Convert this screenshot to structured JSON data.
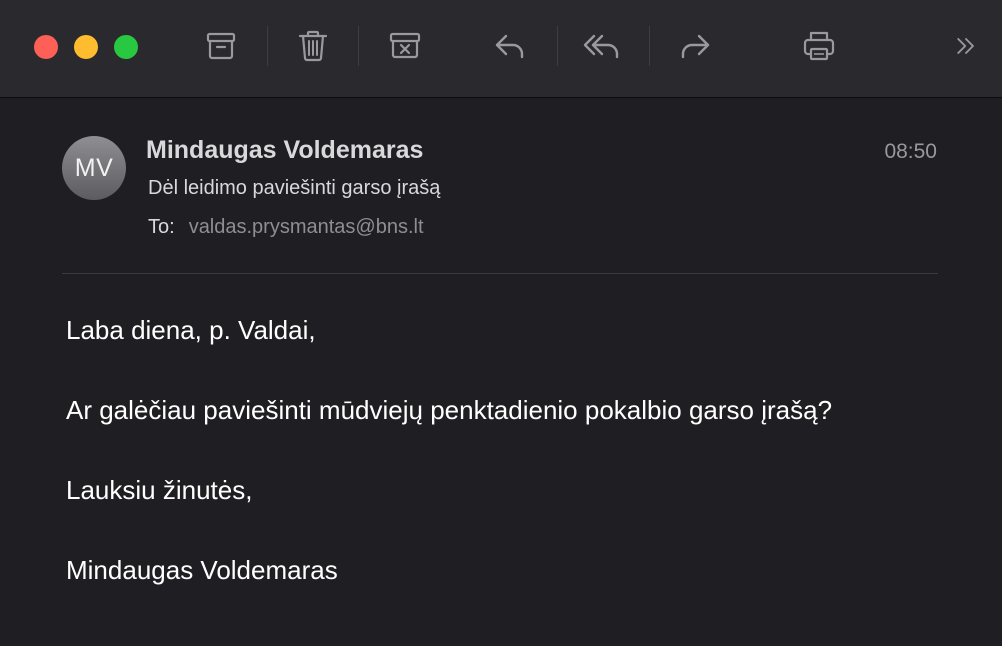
{
  "window": {
    "traffic_lights": {
      "close": "#fe5f57",
      "minimize": "#febc2e",
      "maximize": "#28c840"
    }
  },
  "toolbar": {
    "icons": [
      "archive-icon",
      "trash-icon",
      "junk-icon",
      "reply-icon",
      "reply-all-icon",
      "forward-icon",
      "print-icon",
      "more-icon"
    ]
  },
  "message": {
    "avatar_initials": "MV",
    "sender": "Mindaugas Voldemaras",
    "time": "08:50",
    "subject": "Dėl leidimo paviešinti garso įrašą",
    "to_label": "To:",
    "to_address": "valdas.prysmantas@bns.lt",
    "body": {
      "greeting": "Laba diena, p. Valdai,",
      "question": "Ar galėčiau paviešinti mūdviejų penktadienio pokalbio garso įrašą?",
      "closing": "Lauksiu žinutės,",
      "signature": "Mindaugas Voldemaras"
    }
  }
}
